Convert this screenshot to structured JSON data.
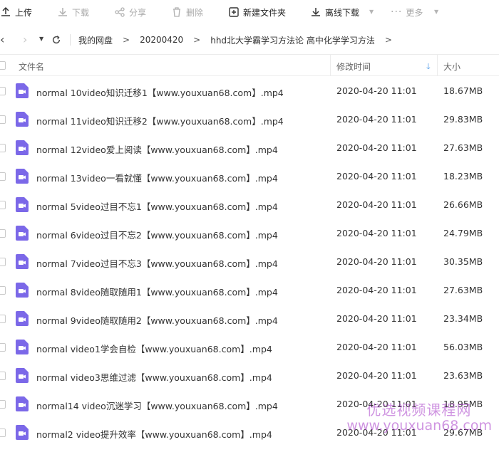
{
  "toolbar": {
    "upload": "上传",
    "download": "下载",
    "share": "分享",
    "delete": "删除",
    "new_folder": "新建文件夹",
    "offline_download": "离线下载",
    "more": "更多"
  },
  "breadcrumb": [
    "我的网盘",
    "20200420",
    "hhd北大学霸学习方法论 高中化学学习方法"
  ],
  "columns": {
    "name": "文件名",
    "modified": "修改时间",
    "size": "大小"
  },
  "files": [
    {
      "name": "normal  10video知识迁移1【www.youxuan68.com】.mp4",
      "modified": "2020-04-20 11:01",
      "size": "18.67MB"
    },
    {
      "name": "normal 11video知识迁移2【www.youxuan68.com】.mp4",
      "modified": "2020-04-20 11:01",
      "size": "29.83MB"
    },
    {
      "name": "normal 12video爱上阅读【www.youxuan68.com】.mp4",
      "modified": "2020-04-20 11:01",
      "size": "27.63MB"
    },
    {
      "name": "normal 13video一看就懂【www.youxuan68.com】.mp4",
      "modified": "2020-04-20 11:01",
      "size": "18.23MB"
    },
    {
      "name": "normal 5video过目不忘1【www.youxuan68.com】.mp4",
      "modified": "2020-04-20 11:01",
      "size": "26.66MB"
    },
    {
      "name": "normal 6video过目不忘2【www.youxuan68.com】.mp4",
      "modified": "2020-04-20 11:01",
      "size": "24.79MB"
    },
    {
      "name": "normal 7video过目不忘3【www.youxuan68.com】.mp4",
      "modified": "2020-04-20 11:01",
      "size": "30.35MB"
    },
    {
      "name": "normal 8video随取随用1【www.youxuan68.com】.mp4",
      "modified": "2020-04-20 11:01",
      "size": "27.63MB"
    },
    {
      "name": "normal 9video随取随用2【www.youxuan68.com】.mp4",
      "modified": "2020-04-20 11:01",
      "size": "23.34MB"
    },
    {
      "name": "normal video1学会自检【www.youxuan68.com】.mp4",
      "modified": "2020-04-20 11:01",
      "size": "56.03MB"
    },
    {
      "name": "normal video3思维过滤【www.youxuan68.com】.mp4",
      "modified": "2020-04-20 11:01",
      "size": "23.63MB"
    },
    {
      "name": "normal14 video沉迷学习【www.youxuan68.com】.mp4",
      "modified": "2020-04-20 11:01",
      "size": "18.95MB"
    },
    {
      "name": "normal2 video提升效率【www.youxuan68.com】.mp4",
      "modified": "2020-04-20 11:01",
      "size": "29.67MB"
    }
  ],
  "watermark": {
    "line1": "优选视频课程网",
    "line2": "www.youxuan68.com"
  },
  "colors": {
    "video_icon": "#7b68e8",
    "accent": "#3a8fe8",
    "watermark": "#a83cc8"
  }
}
